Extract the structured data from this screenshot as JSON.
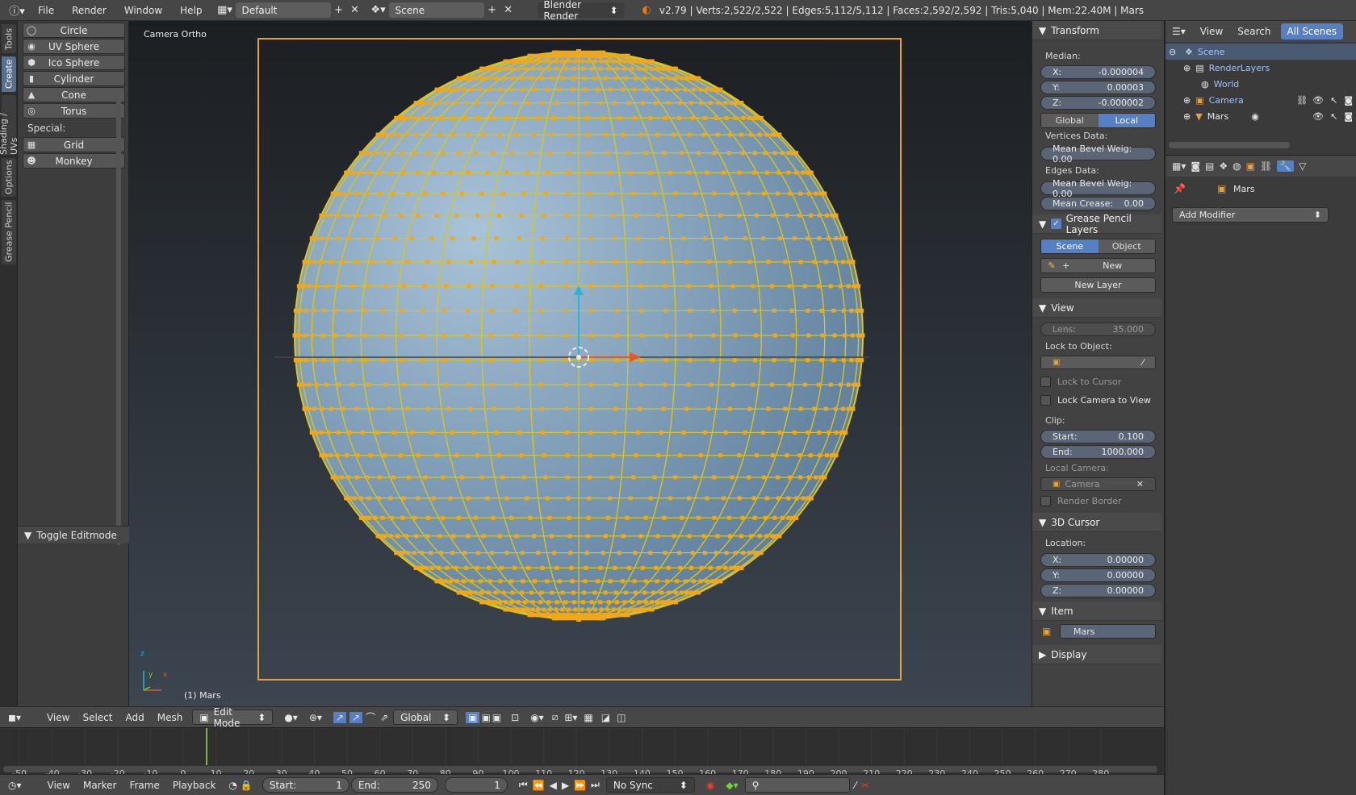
{
  "topbar": {
    "menus": [
      "File",
      "Render",
      "Window",
      "Help"
    ],
    "screen_layout": "Default",
    "scene": "Scene",
    "render_engine": "Blender Render",
    "stats": "v2.79 | Verts:2,522/2,522 | Edges:5,112/5,112 | Faces:2,592/2,592 | Tris:5,040 | Mem:22.40M | Mars"
  },
  "tool_tabs": [
    "Tools",
    "Create",
    "Shading / UVs",
    "Options",
    "Grease Pencil"
  ],
  "toolshelf": {
    "primitives": [
      "Circle",
      "UV Sphere",
      "Ico Sphere",
      "Cylinder",
      "Cone",
      "Torus"
    ],
    "special_label": "Special:",
    "special": [
      "Grid",
      "Monkey"
    ],
    "operator_panel": "Toggle Editmode"
  },
  "viewport": {
    "view_name": "Camera Ortho",
    "object_label": "(1) Mars",
    "axis_z": "z",
    "axis_y": "y",
    "axis_x": "x"
  },
  "npanel": {
    "transform": {
      "title": "Transform",
      "median_label": "Median:",
      "x_label": "X:",
      "x": "-0.000004",
      "y_label": "Y:",
      "y": "0.00003",
      "z_label": "Z:",
      "z": "-0.000002",
      "global": "Global",
      "local": "Local",
      "vertices_data": "Vertices Data:",
      "mean_bevel_v": "Mean Bevel Weig: 0.00",
      "edges_data": "Edges Data:",
      "mean_bevel_e": "Mean Bevel Weig: 0.00",
      "mean_crease_label": "Mean Crease:",
      "mean_crease": "0.00"
    },
    "grease": {
      "title": "Grease Pencil Layers",
      "scene": "Scene",
      "object": "Object",
      "new": "New",
      "new_layer": "New Layer"
    },
    "view": {
      "title": "View",
      "lens_label": "Lens:",
      "lens": "35.000",
      "lock_obj": "Lock to Object:",
      "lock_cursor": "Lock to Cursor",
      "lock_camera": "Lock Camera to View",
      "clip": "Clip:",
      "start_label": "Start:",
      "start": "0.100",
      "end_label": "End:",
      "end": "1000.000",
      "local_camera": "Local Camera:",
      "camera": "Camera",
      "render_border": "Render Border"
    },
    "cursor": {
      "title": "3D Cursor",
      "location": "Location:",
      "x_label": "X:",
      "x": "0.00000",
      "y_label": "Y:",
      "y": "0.00000",
      "z_label": "Z:",
      "z": "0.00000"
    },
    "item": {
      "title": "Item",
      "name": "Mars"
    },
    "display": {
      "title": "Display"
    }
  },
  "outliner": {
    "view": "View",
    "search": "Search",
    "filter": "All Scenes",
    "items": [
      "Scene",
      "RenderLayers",
      "World",
      "Camera",
      "Mars"
    ]
  },
  "properties": {
    "object": "Mars",
    "add_modifier": "Add Modifier"
  },
  "vp_header": {
    "menus": [
      "View",
      "Select",
      "Add",
      "Mesh"
    ],
    "mode": "Edit Mode",
    "orientation": "Global"
  },
  "timeline": {
    "ticks": [
      "-50",
      "-40",
      "-30",
      "-20",
      "-10",
      "0",
      "10",
      "20",
      "30",
      "40",
      "50",
      "60",
      "70",
      "80",
      "90",
      "100",
      "110",
      "120",
      "130",
      "140",
      "150",
      "160",
      "170",
      "180",
      "190",
      "200",
      "210",
      "220",
      "230",
      "240",
      "250",
      "260",
      "270",
      "280"
    ],
    "menus": [
      "View",
      "Marker",
      "Frame",
      "Playback"
    ],
    "start_label": "Start:",
    "start": "1",
    "end_label": "End:",
    "end": "250",
    "current": "1",
    "sync": "No Sync"
  },
  "colors": {
    "accent": "#5680c2",
    "wire": "#e8c21c",
    "camera_frame": "#e8a23c"
  }
}
